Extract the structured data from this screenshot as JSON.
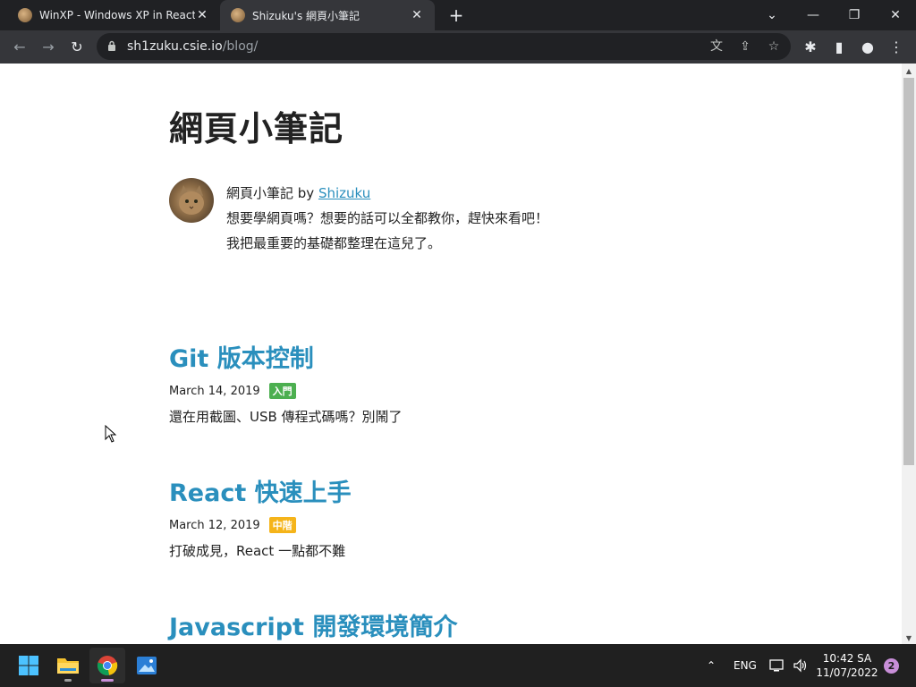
{
  "browser": {
    "tabs": [
      {
        "title": "WinXP - Windows XP in React",
        "active": false
      },
      {
        "title": "Shizuku's 網頁小筆記",
        "active": true
      }
    ],
    "url_host": "sh1zuku.csie.io",
    "url_path": "/blog/"
  },
  "blog": {
    "title": "網頁小筆記",
    "byline_prefix": "網頁小筆記 by ",
    "author": "Shizuku",
    "bio_line1": "想要學網頁嗎？想要的話可以全都教你，趕快來看吧！",
    "bio_line2": "我把最重要的基礎都整理在這兒了。"
  },
  "posts": [
    {
      "title": "Git 版本控制",
      "date": "March 14, 2019",
      "tag": "入門",
      "tag_color": "#4caf50",
      "desc": "還在用截圖、USB 傳程式碼嗎？別鬧了"
    },
    {
      "title": "React 快速上手",
      "date": "March 12, 2019",
      "tag": "中階",
      "tag_color": "#f5b41a",
      "desc": "打破成見，React 一點都不難"
    },
    {
      "title": "Javascript 開發環境簡介",
      "date": "",
      "tag": "",
      "tag_color": "",
      "desc": ""
    }
  ],
  "taskbar": {
    "language": "ENG",
    "time": "10:42 SA",
    "date": "11/07/2022",
    "notification_count": "2"
  }
}
